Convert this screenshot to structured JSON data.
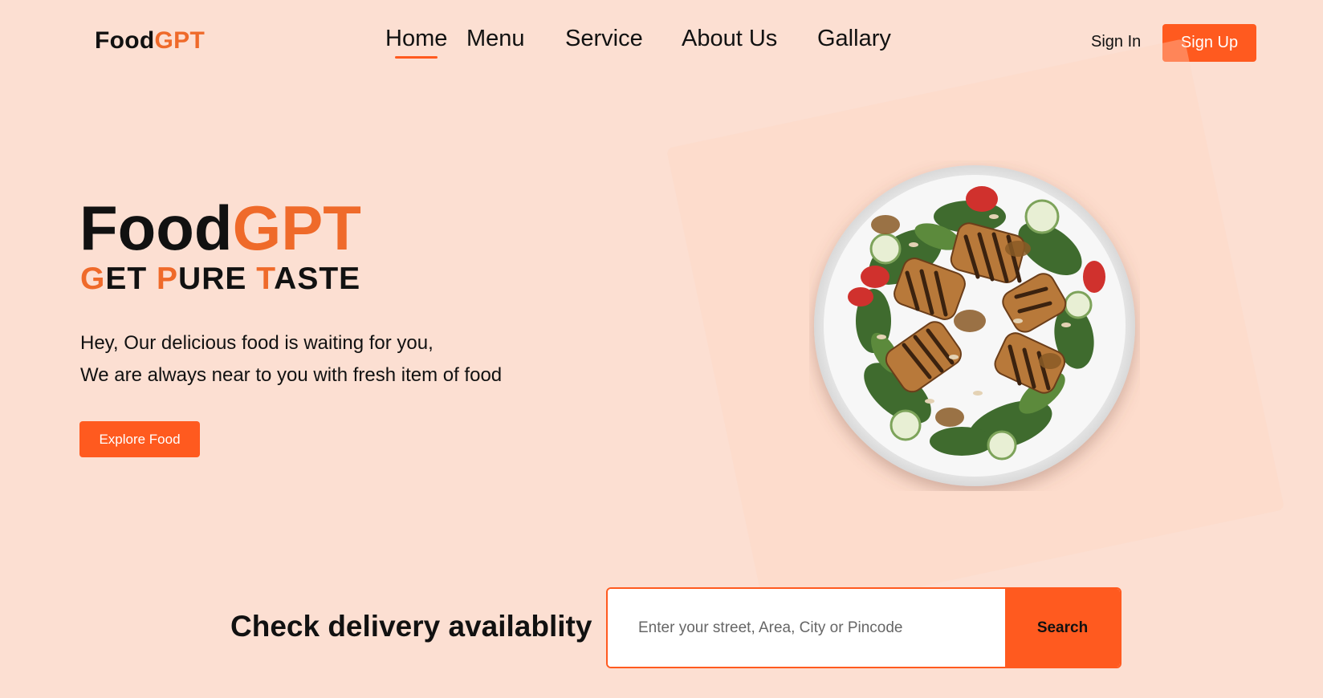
{
  "brand": {
    "name_part1": "Food",
    "name_part2": "GPT"
  },
  "nav": {
    "items": [
      {
        "label": "Home"
      },
      {
        "label": "Menu"
      },
      {
        "label": "Service"
      },
      {
        "label": "About Us"
      },
      {
        "label": "Gallary"
      }
    ],
    "active": "Home"
  },
  "auth": {
    "signin_label": "Sign In",
    "signup_label": "Sign Up"
  },
  "hero": {
    "title_part1": "Food",
    "title_part2": "GPT",
    "tagline": {
      "g": "G",
      "et": "ET ",
      "p": "P",
      "ure": "URE ",
      "t": "T",
      "aste": "ASTE"
    },
    "line1": "Hey, Our delicious food is waiting for you,",
    "line2": "We are always near to you with fresh item of food",
    "cta_label": "Explore Food"
  },
  "delivery": {
    "label": "Check delivery availablity",
    "placeholder": "Enter your street, Area, City or Pincode",
    "search_label": "Search"
  },
  "colors": {
    "accent": "#ef6a2a",
    "button": "#ff5a1f",
    "background": "#fcdfd2"
  },
  "image": {
    "semantic": "salad-plate-image"
  }
}
